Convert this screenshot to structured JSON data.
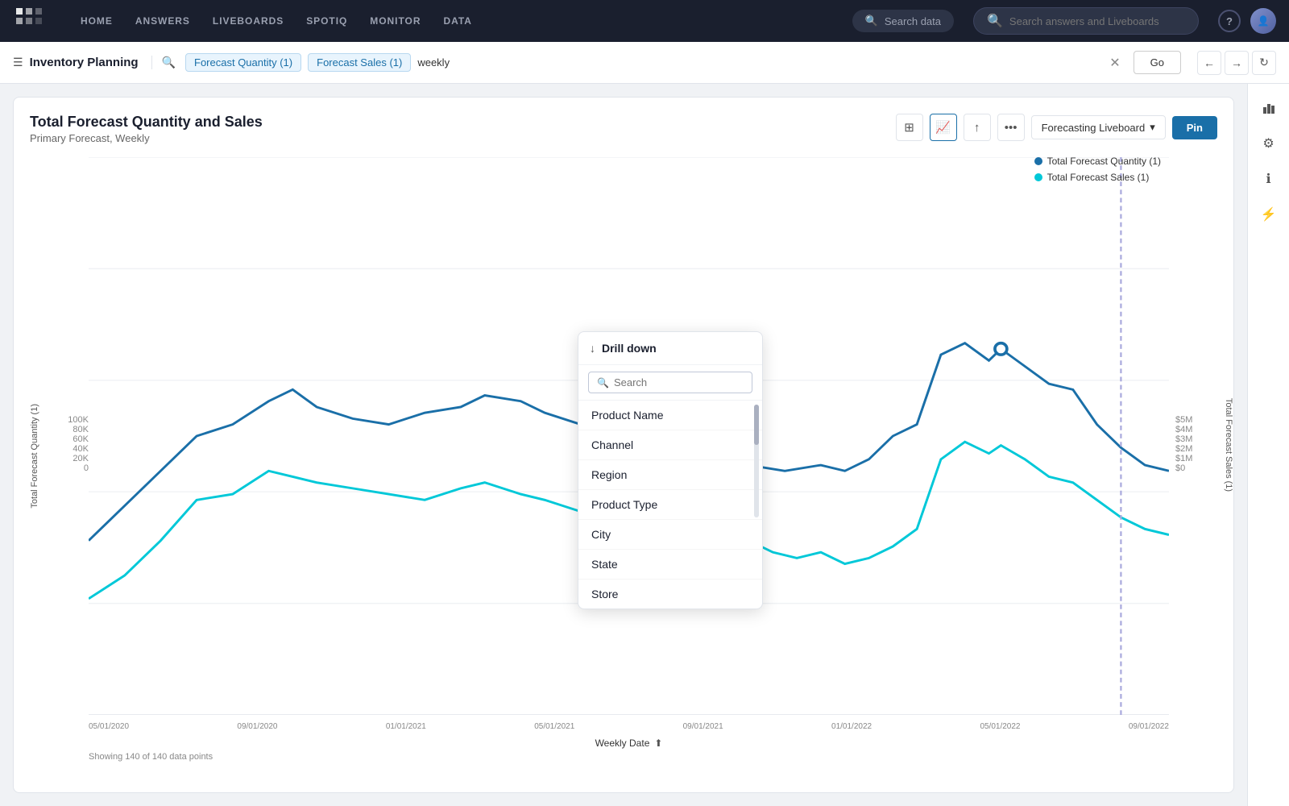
{
  "nav": {
    "links": [
      "HOME",
      "ANSWERS",
      "LIVEBOARDS",
      "SPOTIQ",
      "MONITOR",
      "DATA"
    ],
    "search_data_label": "Search data",
    "search_answers_placeholder": "Search answers and Liveboards"
  },
  "search_bar": {
    "liveboard_icon": "☰",
    "liveboard_title": "Inventory Planning",
    "tokens": [
      "Forecast Quantity (1)",
      "Forecast Sales (1)",
      "weekly"
    ],
    "go_label": "Go"
  },
  "chart": {
    "title": "Total Forecast Quantity and Sales",
    "subtitle": "Primary Forecast, Weekly",
    "liveboard_dropdown": "Forecasting Liveboard",
    "pin_label": "Pin",
    "y_axis_left_labels": [
      "100K",
      "80K",
      "60K",
      "40K",
      "20K",
      "0"
    ],
    "y_axis_right_labels": [
      "$5M",
      "$4M",
      "$3M",
      "$2M",
      "$1M",
      "$0"
    ],
    "y_axis_left_title": "Total Forecast Quantity (1)",
    "y_axis_right_title": "Total Forecast Sales (1)",
    "x_axis_labels": [
      "05/01/2020",
      "09/01/2020",
      "01/01/2021",
      "05/01/2021",
      "09/01/2021",
      "01/01/2022",
      "05/01/2022",
      "09/01/2022"
    ],
    "x_axis_bottom": "Weekly Date",
    "data_points_text": "Showing 140 of 140 data points",
    "legend": [
      {
        "label": "Total Forecast Quantity (1)",
        "color": "#1a6fa8"
      },
      {
        "label": "Total Forecast Sales (1)",
        "color": "#00c0d0"
      }
    ]
  },
  "drill_down": {
    "title": "Drill down",
    "search_placeholder": "Search",
    "items": [
      "Product Name",
      "Channel",
      "Region",
      "Product Type",
      "City",
      "State",
      "Store"
    ]
  }
}
